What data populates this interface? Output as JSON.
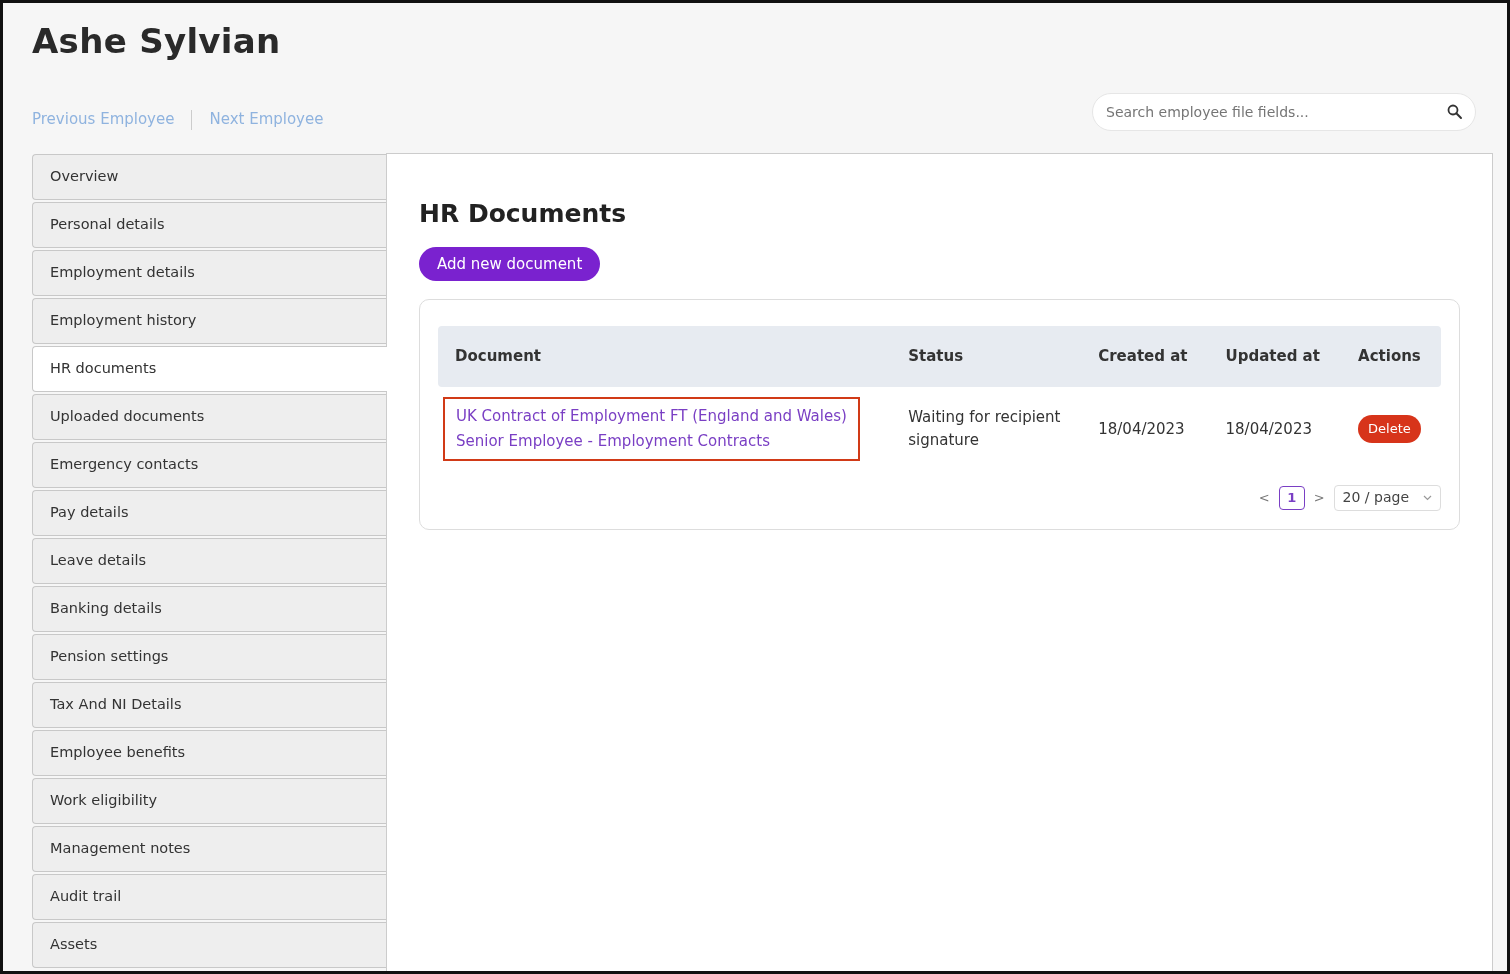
{
  "employee_name": "Ashe Sylvian",
  "nav_links": [
    "Previous Employee",
    "Next Employee"
  ],
  "search": {
    "placeholder": "Search employee file fields..."
  },
  "sidebar": {
    "items": [
      {
        "label": "Overview",
        "selected": false
      },
      {
        "label": "Personal details",
        "selected": false
      },
      {
        "label": "Employment details",
        "selected": false
      },
      {
        "label": "Employment history",
        "selected": false
      },
      {
        "label": "HR documents",
        "selected": true
      },
      {
        "label": "Uploaded documents",
        "selected": false
      },
      {
        "label": "Emergency contacts",
        "selected": false
      },
      {
        "label": "Pay details",
        "selected": false
      },
      {
        "label": "Leave details",
        "selected": false
      },
      {
        "label": "Banking details",
        "selected": false
      },
      {
        "label": "Pension settings",
        "selected": false
      },
      {
        "label": "Tax And NI Details",
        "selected": false
      },
      {
        "label": "Employee benefits",
        "selected": false
      },
      {
        "label": "Work eligibility",
        "selected": false
      },
      {
        "label": "Management notes",
        "selected": false
      },
      {
        "label": "Audit trail",
        "selected": false
      },
      {
        "label": "Assets",
        "selected": false
      }
    ]
  },
  "main": {
    "title": "HR Documents",
    "add_button": "Add new document",
    "table": {
      "columns": [
        "Document",
        "Status",
        "Created at",
        "Updated at",
        "Actions"
      ],
      "rows": [
        {
          "document_title": "UK Contract of Employment FT (England and Wales)",
          "document_subtitle": "Senior Employee - Employment Contracts",
          "highlighted": true,
          "status": "Waiting for recipient signature",
          "created_at": "18/04/2023",
          "updated_at": "18/04/2023",
          "action": "Delete"
        }
      ]
    },
    "pagination": {
      "prev": "<",
      "pages": [
        {
          "label": "1",
          "selected": true
        }
      ],
      "next": ">",
      "page_size": "20 / page"
    }
  }
}
